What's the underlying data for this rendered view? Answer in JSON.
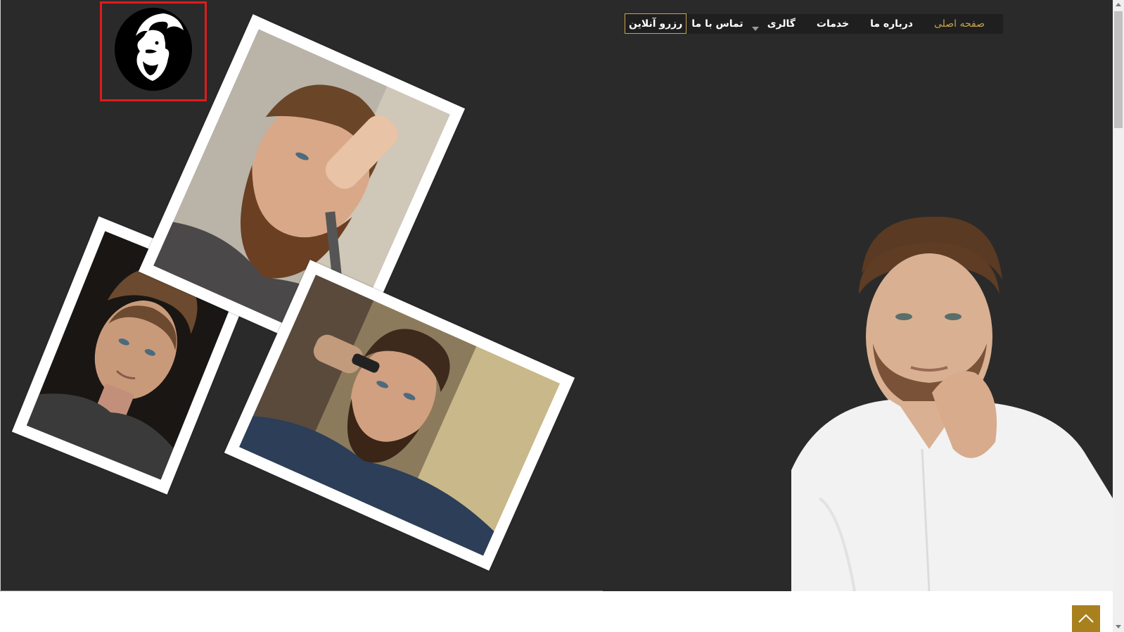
{
  "nav": {
    "items": [
      {
        "label": "صفحه اصلی",
        "active": true
      },
      {
        "label": "درباره ما",
        "active": false
      },
      {
        "label": "خدمات",
        "active": false
      },
      {
        "label": "گالری",
        "active": false,
        "has_dropdown": true
      },
      {
        "label": "تماس با ما",
        "active": false
      }
    ],
    "reserve_label": "رزرو آنلاین"
  },
  "logo": {
    "icon": "bearded-man-logo-icon"
  },
  "gallery_photos": [
    {
      "icon": "man-portrait-photo",
      "description_tag": "hair-style"
    },
    {
      "icon": "beard-shave-photo",
      "description_tag": "beard-trim"
    },
    {
      "icon": "haircut-clipper-photo",
      "description_tag": "haircut"
    }
  ],
  "hero_model": {
    "icon": "model-portrait-photo"
  },
  "back_to_top": {
    "icon": "chevron-up-icon"
  },
  "colors": {
    "background": "#2a2a2a",
    "nav_bg": "#1f1f1f",
    "accent_gold": "#c9a349",
    "back_top_bg": "#a8811e",
    "logo_outline": "#e01b1b"
  }
}
